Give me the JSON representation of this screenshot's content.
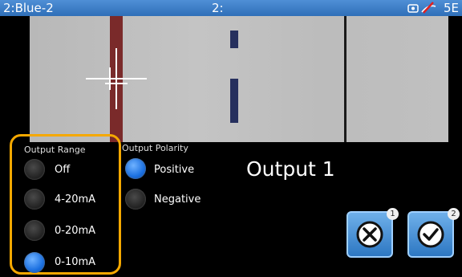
{
  "statusbar": {
    "left": "2:Blue-2",
    "center": "2:",
    "right": "5E",
    "icons": [
      "camera-icon",
      "signal-off-icon"
    ]
  },
  "output_range": {
    "title": "Output Range",
    "options": [
      {
        "label": "Off",
        "selected": false
      },
      {
        "label": "4-20mA",
        "selected": false
      },
      {
        "label": "0-20mA",
        "selected": false
      },
      {
        "label": "0-10mA",
        "selected": true
      }
    ]
  },
  "output_polarity": {
    "title": "Output Polarity",
    "options": [
      {
        "label": "Positive",
        "selected": true
      },
      {
        "label": "Negative",
        "selected": false
      }
    ]
  },
  "output_title": "Output 1",
  "actions": {
    "cancel": {
      "icon": "cancel-x-icon",
      "badge": "1"
    },
    "confirm": {
      "icon": "checkmark-icon",
      "badge": "2"
    }
  },
  "colors": {
    "accent": "#1a6fe0",
    "highlight": "#f5a800",
    "statusbar": "#3a7cc4"
  }
}
